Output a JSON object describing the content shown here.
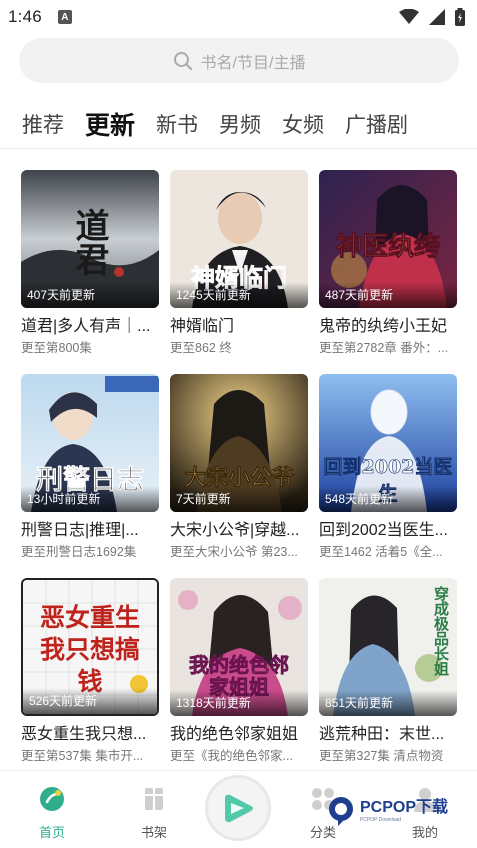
{
  "status_bar": {
    "time": "1:46",
    "notification_glyph": "A"
  },
  "search": {
    "placeholder": "书名/节目/主播"
  },
  "tabs": [
    {
      "label": "推荐",
      "active": false
    },
    {
      "label": "更新",
      "active": true
    },
    {
      "label": "新书",
      "active": false
    },
    {
      "label": "男频",
      "active": false
    },
    {
      "label": "女频",
      "active": false
    },
    {
      "label": "广播剧",
      "active": false
    }
  ],
  "books": [
    {
      "title": "道君|多人有声｜...",
      "subtitle": "更至第800集",
      "updated": "407天前更新",
      "cover_text": "道君",
      "palette": [
        "#cfd3d6",
        "#3b3f44"
      ]
    },
    {
      "title": "神婿临门",
      "subtitle": "更至862 终",
      "updated": "1245天前更新",
      "cover_text": "神婿临门",
      "palette": [
        "#e9e2da",
        "#2a2a2e"
      ]
    },
    {
      "title": "鬼帝的纨绔小王妃",
      "subtitle": "更至第2782章 番外：...",
      "updated": "487天前更新",
      "cover_text": "神医纨绔",
      "palette": [
        "#3a2a5c",
        "#b0354a"
      ]
    },
    {
      "title": "刑警日志|推理|...",
      "subtitle": "更至刑警日志1692集",
      "updated": "13小时前更新",
      "cover_text": "刑警日志",
      "palette": [
        "#9fc7e6",
        "#23324a"
      ]
    },
    {
      "title": "大宋小公爷|穿越...",
      "subtitle": "更至大宋小公爷 第23...",
      "updated": "7天前更新",
      "cover_text": "大宋小公爷",
      "palette": [
        "#3d3220",
        "#c48a2c"
      ]
    },
    {
      "title": "回到2002当医生...",
      "subtitle": "更至1462 活着5《全...",
      "updated": "548天前更新",
      "cover_text": "回到2002当医生",
      "palette": [
        "#1d3f9b",
        "#7fb2ea"
      ]
    },
    {
      "title": "恶女重生我只想...",
      "subtitle": "更至第537集 集市开...",
      "updated": "526天前更新",
      "cover_text": "恶女重生我只想搞钱",
      "palette": [
        "#f3f3f3",
        "#c0231c"
      ]
    },
    {
      "title": "我的绝色邻家姐姐",
      "subtitle": "更至《我的绝色邻家...",
      "updated": "1318天前更新",
      "cover_text": "我的绝色邻家姐姐",
      "palette": [
        "#e7e1dc",
        "#b03a8e"
      ]
    },
    {
      "title": "逃荒种田：末世...",
      "subtitle": "更至第327集 清点物资",
      "updated": "851天前更新",
      "cover_text": "穿成极品长姐",
      "palette": [
        "#eef0ec",
        "#8aa86a"
      ]
    }
  ],
  "bottom_nav": [
    {
      "label": "首页",
      "icon": "home-icon",
      "active": true
    },
    {
      "label": "书架",
      "icon": "bookshelf-icon",
      "active": false
    },
    {
      "label": "分类",
      "icon": "category-icon",
      "active": false
    },
    {
      "label": "我的",
      "icon": "profile-icon",
      "active": false
    }
  ],
  "watermark": {
    "text": "PCPOP下载",
    "sub": "PCPOP Download"
  },
  "colors": {
    "accent": "#2fae8e",
    "muted": "#777777"
  }
}
